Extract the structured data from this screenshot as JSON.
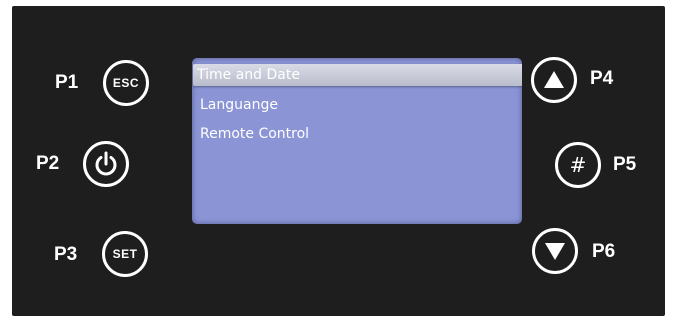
{
  "menu": {
    "items": [
      {
        "label": "Time and Date",
        "selected": true
      },
      {
        "label": "Languange",
        "selected": false
      },
      {
        "label": "Remote Control",
        "selected": false
      }
    ]
  },
  "buttons": {
    "p1": {
      "label": "P1",
      "text": "ESC"
    },
    "p2": {
      "label": "P2",
      "icon": "power-icon"
    },
    "p3": {
      "label": "P3",
      "text": "SET"
    },
    "p4": {
      "label": "P4",
      "icon": "arrow-up-icon"
    },
    "p5": {
      "label": "P5",
      "text": "#"
    },
    "p6": {
      "label": "P6",
      "icon": "arrow-down-icon"
    }
  },
  "colors": {
    "frame": "#1e1e1e",
    "lcd": "#8b95d6",
    "text": "#ffffff"
  }
}
